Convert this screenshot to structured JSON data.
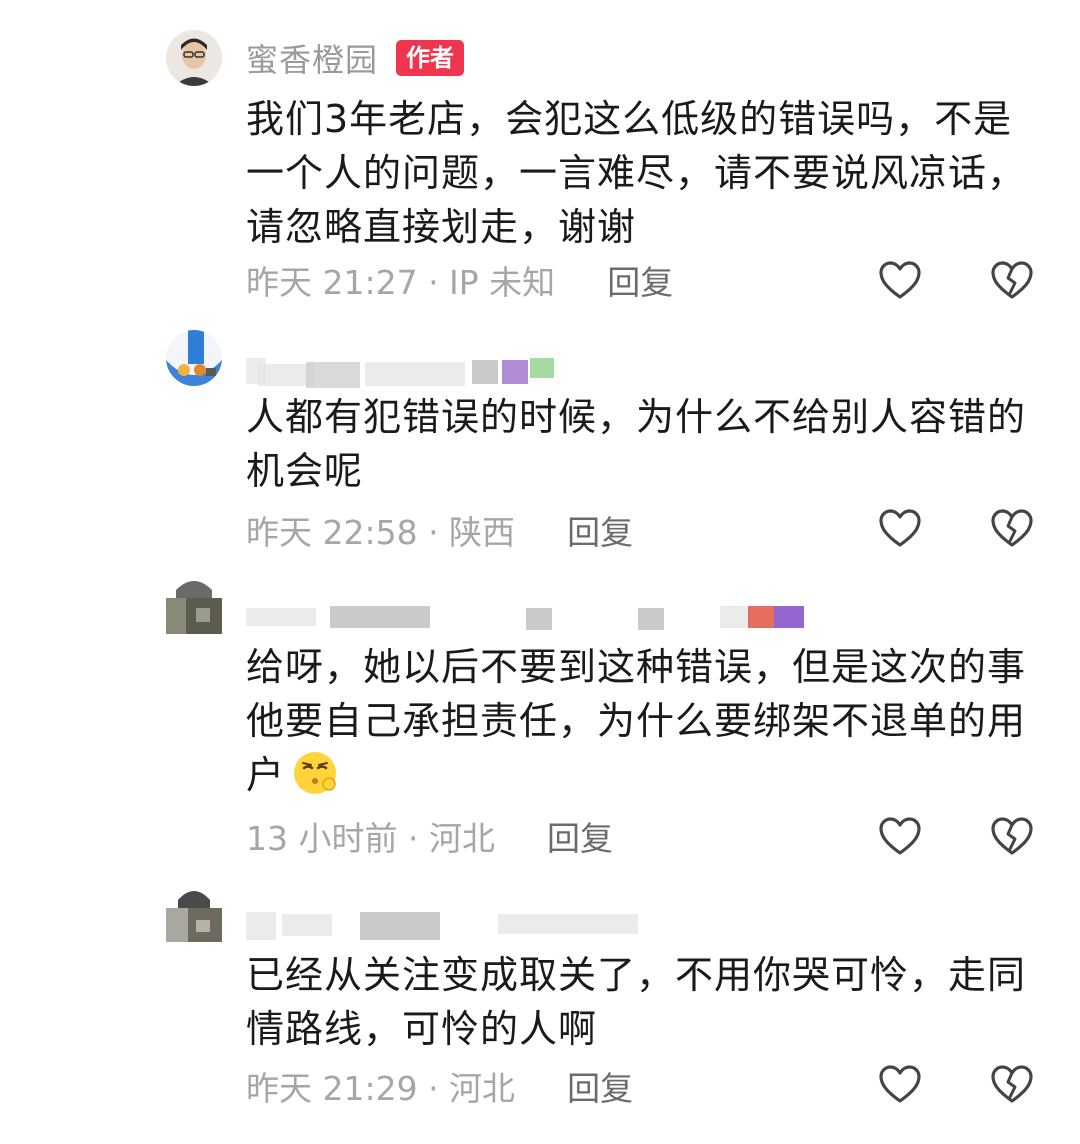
{
  "comments": [
    {
      "username": "蜜香橙园",
      "badge": "作者",
      "text": "我们3年老店，会犯这么低级的错误吗，不是一个人的问题，一言难尽，请不要说风凉话，请忽略直接划走，谢谢",
      "meta": "昨天 21:27 · IP 未知",
      "reply": "回复",
      "like_icon": "heart-outline-icon",
      "dislike_icon": "broken-heart-icon"
    },
    {
      "username": "",
      "text": "人都有犯错误的时候，为什么不给别人容错的机会呢",
      "meta": "昨天 22:58 · 陕西",
      "reply": "回复",
      "like_icon": "heart-outline-icon",
      "dislike_icon": "broken-heart-icon"
    },
    {
      "username": "",
      "text": "给呀，她以后不要到这种错误，但是这次的事他要自己承担责任，为什么要绑架不退单的用户",
      "emoji": "pouting-face-emoji",
      "meta": "13 小时前 · 河北",
      "reply": "回复",
      "like_icon": "heart-outline-icon",
      "dislike_icon": "broken-heart-icon"
    },
    {
      "username": "",
      "text": "已经从关注变成取关了，不用你哭可怜，走同情路线，可怜的人啊",
      "meta": "昨天 21:29 · 河北",
      "reply": "回复",
      "like_icon": "heart-outline-icon",
      "dislike_icon": "broken-heart-icon"
    }
  ],
  "colors": {
    "badge": "#f0354f",
    "meta": "#a6a6a6",
    "username": "#9a9a9a",
    "text": "#1a1a1a"
  }
}
